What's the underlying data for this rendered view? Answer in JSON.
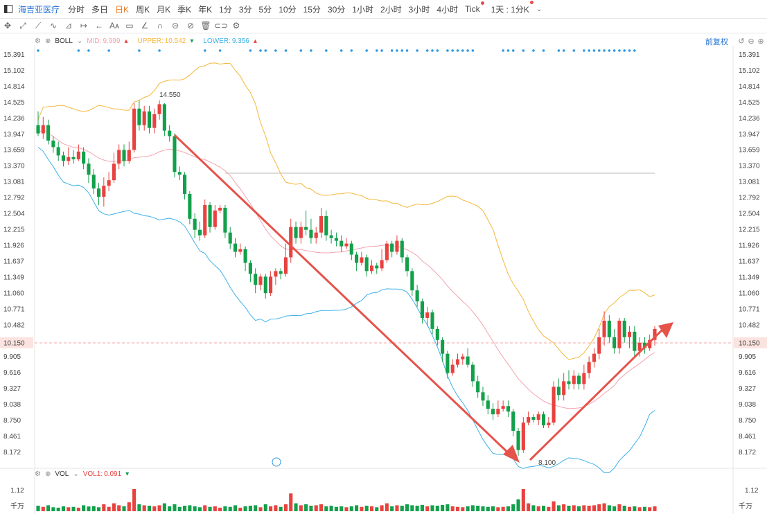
{
  "stock_name": "海吉亚医疗",
  "tabs": [
    "分时",
    "多日",
    "日K",
    "周K",
    "月K",
    "季K",
    "年K",
    "1分",
    "3分",
    "5分",
    "10分",
    "15分",
    "30分",
    "1小时",
    "2小时",
    "3小时",
    "4小时",
    "Tick",
    "1天 : 1分K"
  ],
  "active_tab": "日K",
  "indicator": {
    "name": "BOLL",
    "mid_label": "MID:",
    "mid_value": "9.999",
    "upper_label": "UPPER:",
    "upper_value": "10.542",
    "lower_label": "LOWER:",
    "lower_value": "9.356"
  },
  "volume_indicator": {
    "name": "VOL",
    "vol1_label": "VOL1:",
    "vol1_value": "0.091",
    "axis_top": "1.12",
    "unit": "千万"
  },
  "fq_label": "前复权",
  "colors": {
    "up": "#e8423f",
    "down": "#12a04b",
    "upper": "#f5b63a",
    "mid": "#f3a3ad",
    "lower": "#3eb1e8",
    "arrow": "#e5534b",
    "dot": "#2e9ae0",
    "price_line": "#f4a6a0"
  },
  "chart_data": {
    "type": "candlestick",
    "y_ticks": [
      "15.391",
      "15.102",
      "14.814",
      "14.525",
      "14.236",
      "13.947",
      "13.659",
      "13.370",
      "13.081",
      "12.792",
      "12.504",
      "12.215",
      "11.926",
      "11.637",
      "11.349",
      "11.060",
      "10.771",
      "10.482",
      "10.150",
      "9.905",
      "9.616",
      "9.327",
      "9.038",
      "8.750",
      "8.461",
      "8.172"
    ],
    "y_range": [
      7.95,
      15.52
    ],
    "current_price": "10.150",
    "high_label": "14.550",
    "low_label": "8.100",
    "candles": [
      [
        14.1,
        13.95,
        14.35,
        13.9
      ],
      [
        13.95,
        14.1,
        14.25,
        13.85
      ],
      [
        14.1,
        13.82,
        14.2,
        13.75
      ],
      [
        13.82,
        13.7,
        13.9,
        13.6
      ],
      [
        13.7,
        13.55,
        13.8,
        13.45
      ],
      [
        13.55,
        13.45,
        13.62,
        13.35
      ],
      [
        13.45,
        13.52,
        13.7,
        13.38
      ],
      [
        13.52,
        13.48,
        13.65,
        13.4
      ],
      [
        13.48,
        13.62,
        13.75,
        13.45
      ],
      [
        13.62,
        13.4,
        13.7,
        13.3
      ],
      [
        13.4,
        13.2,
        13.5,
        13.05
      ],
      [
        13.2,
        12.95,
        13.3,
        12.85
      ],
      [
        12.95,
        12.8,
        13.05,
        12.65
      ],
      [
        12.8,
        13.0,
        13.15,
        12.62
      ],
      [
        13.0,
        13.1,
        13.25,
        12.9
      ],
      [
        13.1,
        13.4,
        13.6,
        13.05
      ],
      [
        13.4,
        13.65,
        13.75,
        13.3
      ],
      [
        13.65,
        13.45,
        13.75,
        13.35
      ],
      [
        13.45,
        13.65,
        13.8,
        13.4
      ],
      [
        13.65,
        14.4,
        14.5,
        13.6
      ],
      [
        14.4,
        14.1,
        14.55,
        14.0
      ],
      [
        14.1,
        14.35,
        14.45,
        14.0
      ],
      [
        14.35,
        14.05,
        14.45,
        13.95
      ],
      [
        14.05,
        14.3,
        14.4,
        13.95
      ],
      [
        14.3,
        14.48,
        14.55,
        14.2
      ],
      [
        14.48,
        14.0,
        14.5,
        13.9
      ],
      [
        14.0,
        13.9,
        14.1,
        13.8
      ],
      [
        13.9,
        13.25,
        13.95,
        13.15
      ],
      [
        13.25,
        13.2,
        13.35,
        13.1
      ],
      [
        13.2,
        12.85,
        13.25,
        12.75
      ],
      [
        12.85,
        12.4,
        12.9,
        12.3
      ],
      [
        12.4,
        12.2,
        12.5,
        12.05
      ],
      [
        12.2,
        12.1,
        12.35,
        12.0
      ],
      [
        12.1,
        12.65,
        12.75,
        12.05
      ],
      [
        12.65,
        12.25,
        12.7,
        12.15
      ],
      [
        12.25,
        12.55,
        12.65,
        12.2
      ],
      [
        12.55,
        12.6,
        12.65,
        12.5
      ],
      [
        12.6,
        12.15,
        12.65,
        12.05
      ],
      [
        12.15,
        11.95,
        12.25,
        11.85
      ],
      [
        11.95,
        11.8,
        12.05,
        11.7
      ],
      [
        11.8,
        11.85,
        11.95,
        11.75
      ],
      [
        11.85,
        11.6,
        11.9,
        11.45
      ],
      [
        11.6,
        11.4,
        11.65,
        11.25
      ],
      [
        11.4,
        11.2,
        11.5,
        11.05
      ],
      [
        11.2,
        11.35,
        11.4,
        11.1
      ],
      [
        11.35,
        11.05,
        11.4,
        10.95
      ],
      [
        11.05,
        11.35,
        11.45,
        11.0
      ],
      [
        11.35,
        11.45,
        11.5,
        11.2
      ],
      [
        11.45,
        11.4,
        11.5,
        11.3
      ],
      [
        11.4,
        11.7,
        11.95,
        11.35
      ],
      [
        11.7,
        12.25,
        12.4,
        11.6
      ],
      [
        12.25,
        12.05,
        12.35,
        11.95
      ],
      [
        12.05,
        12.25,
        12.35,
        11.95
      ],
      [
        12.25,
        12.2,
        12.55,
        12.1
      ],
      [
        12.2,
        12.05,
        12.4,
        11.95
      ],
      [
        12.05,
        12.15,
        12.25,
        11.95
      ],
      [
        12.15,
        12.45,
        12.6,
        12.05
      ],
      [
        12.45,
        12.1,
        12.55,
        12.0
      ],
      [
        12.1,
        12.05,
        12.2,
        11.95
      ],
      [
        12.05,
        12.0,
        12.15,
        11.9
      ],
      [
        12.0,
        11.9,
        12.1,
        11.8
      ],
      [
        11.9,
        11.95,
        12.05,
        11.85
      ],
      [
        11.95,
        11.75,
        12.0,
        11.65
      ],
      [
        11.75,
        11.6,
        11.8,
        11.45
      ],
      [
        11.6,
        11.7,
        11.8,
        11.55
      ],
      [
        11.7,
        11.45,
        11.75,
        11.35
      ],
      [
        11.45,
        11.55,
        11.65,
        11.4
      ],
      [
        11.55,
        11.5,
        11.6,
        11.4
      ],
      [
        11.5,
        11.65,
        11.85,
        11.45
      ],
      [
        11.65,
        11.95,
        12.0,
        11.6
      ],
      [
        11.95,
        11.8,
        12.0,
        11.7
      ],
      [
        11.8,
        12.0,
        12.1,
        11.75
      ],
      [
        12.0,
        11.7,
        12.05,
        11.6
      ],
      [
        11.7,
        11.45,
        11.75,
        11.35
      ],
      [
        11.45,
        11.1,
        11.5,
        11.0
      ],
      [
        11.1,
        10.9,
        11.2,
        10.8
      ],
      [
        10.9,
        10.6,
        10.95,
        10.5
      ],
      [
        10.6,
        10.7,
        10.8,
        10.45
      ],
      [
        10.7,
        10.4,
        10.75,
        10.3
      ],
      [
        10.4,
        10.2,
        10.45,
        10.1
      ],
      [
        10.2,
        9.95,
        10.25,
        9.8
      ],
      [
        9.95,
        9.6,
        10.0,
        9.5
      ],
      [
        9.6,
        9.75,
        9.85,
        9.55
      ],
      [
        9.75,
        9.85,
        9.95,
        9.7
      ],
      [
        9.85,
        9.9,
        9.95,
        9.75
      ],
      [
        9.9,
        9.75,
        10.05,
        9.7
      ],
      [
        9.75,
        9.45,
        9.8,
        9.35
      ],
      [
        9.45,
        9.25,
        9.55,
        9.15
      ],
      [
        9.25,
        9.1,
        9.35,
        9.0
      ],
      [
        9.1,
        8.95,
        9.2,
        8.85
      ],
      [
        8.95,
        8.85,
        9.05,
        8.75
      ],
      [
        8.85,
        8.95,
        9.1,
        8.8
      ],
      [
        8.95,
        9.0,
        9.1,
        8.9
      ],
      [
        9.0,
        8.9,
        9.1,
        8.8
      ],
      [
        8.9,
        8.55,
        8.95,
        8.45
      ],
      [
        8.55,
        8.2,
        8.6,
        8.1
      ],
      [
        8.2,
        8.7,
        8.8,
        8.15
      ],
      [
        8.7,
        8.8,
        8.9,
        8.65
      ],
      [
        8.8,
        8.75,
        8.85,
        8.7
      ],
      [
        8.75,
        8.85,
        8.9,
        8.65
      ],
      [
        8.85,
        8.65,
        8.9,
        8.6
      ],
      [
        8.65,
        8.7,
        8.8,
        8.6
      ],
      [
        8.7,
        9.35,
        9.45,
        8.65
      ],
      [
        9.35,
        9.2,
        9.5,
        9.1
      ],
      [
        9.2,
        9.45,
        9.6,
        9.1
      ],
      [
        9.45,
        9.4,
        9.65,
        9.3
      ],
      [
        9.4,
        9.55,
        9.65,
        9.3
      ],
      [
        9.55,
        9.4,
        9.6,
        9.3
      ],
      [
        9.4,
        9.6,
        9.75,
        9.3
      ],
      [
        9.6,
        9.8,
        9.9,
        9.5
      ],
      [
        9.8,
        9.95,
        10.05,
        9.7
      ],
      [
        9.95,
        10.25,
        10.4,
        9.85
      ],
      [
        10.25,
        10.55,
        10.72,
        10.1
      ],
      [
        10.55,
        10.25,
        10.65,
        10.15
      ],
      [
        10.25,
        10.05,
        10.4,
        9.95
      ],
      [
        10.05,
        10.55,
        10.6,
        9.95
      ],
      [
        10.55,
        10.25,
        10.6,
        10.15
      ],
      [
        10.25,
        10.35,
        10.45,
        10.05
      ],
      [
        10.35,
        10.0,
        10.45,
        9.9
      ],
      [
        10.0,
        10.15,
        10.25,
        9.9
      ],
      [
        10.15,
        10.05,
        10.25,
        9.95
      ],
      [
        10.05,
        10.2,
        10.3,
        10.0
      ],
      [
        10.2,
        10.4,
        10.45,
        10.1
      ]
    ],
    "volume_up": [
      0,
      0,
      0,
      0,
      0,
      0,
      0,
      0,
      0,
      0,
      0,
      0,
      0,
      0,
      0,
      0,
      0,
      0,
      0,
      0,
      1,
      0,
      0,
      0,
      0,
      0,
      0,
      0,
      0,
      0,
      0,
      0,
      0,
      0,
      0,
      0,
      0,
      0,
      0,
      0,
      0,
      0,
      0,
      0,
      0,
      0,
      0,
      0,
      0,
      0,
      1,
      0,
      0,
      0,
      0,
      0,
      0,
      0,
      0,
      0,
      0,
      0,
      0,
      0,
      0,
      0,
      0,
      0,
      0,
      0,
      0,
      0,
      0,
      0,
      0,
      0,
      0,
      0,
      0,
      0,
      0,
      0,
      0,
      0,
      0,
      0,
      0,
      0,
      0,
      0,
      0,
      0,
      0,
      0,
      0,
      0,
      1,
      0,
      0,
      0,
      0,
      0,
      0,
      0,
      0,
      0,
      0,
      0,
      0,
      0,
      0,
      0,
      0,
      0,
      0,
      0,
      0,
      0,
      0,
      0,
      0,
      0
    ],
    "volume": [
      0.28,
      0.22,
      0.3,
      0.2,
      0.18,
      0.25,
      0.2,
      0.22,
      0.18,
      0.3,
      0.24,
      0.26,
      0.2,
      0.35,
      0.22,
      0.4,
      0.3,
      0.25,
      0.45,
      1.12,
      0.35,
      0.3,
      0.28,
      0.25,
      0.3,
      0.4,
      0.25,
      0.35,
      0.22,
      0.28,
      0.3,
      0.25,
      0.2,
      0.3,
      0.22,
      0.25,
      0.18,
      0.25,
      0.22,
      0.3,
      0.18,
      0.25,
      0.28,
      0.3,
      0.2,
      0.35,
      0.25,
      0.3,
      0.22,
      0.35,
      0.9,
      0.4,
      0.3,
      0.35,
      0.28,
      0.3,
      0.35,
      0.25,
      0.28,
      0.22,
      0.25,
      0.2,
      0.25,
      0.3,
      0.22,
      0.28,
      0.25,
      0.2,
      0.3,
      0.4,
      0.25,
      0.3,
      0.28,
      0.35,
      0.3,
      0.28,
      0.32,
      0.25,
      0.3,
      0.28,
      0.32,
      0.35,
      0.25,
      0.22,
      0.2,
      0.25,
      0.3,
      0.28,
      0.25,
      0.22,
      0.25,
      0.2,
      0.22,
      0.25,
      0.35,
      0.6,
      1.12,
      0.4,
      0.3,
      0.25,
      0.28,
      0.22,
      0.5,
      0.3,
      0.35,
      0.28,
      0.3,
      0.25,
      0.3,
      0.28,
      0.3,
      0.35,
      0.4,
      0.3,
      0.25,
      0.35,
      0.28,
      0.22,
      0.25,
      0.2,
      0.22,
      0.2,
      0.25
    ]
  }
}
